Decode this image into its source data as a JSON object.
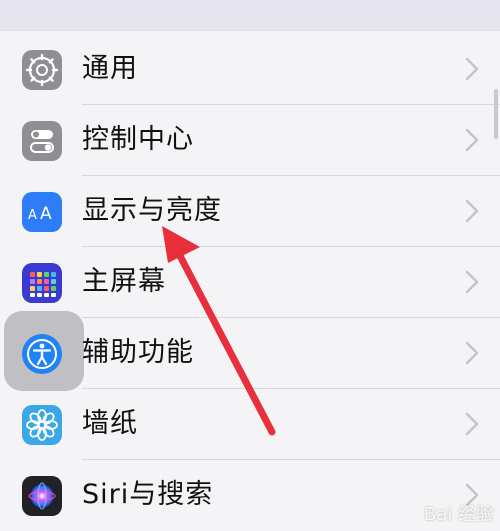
{
  "settings_list": {
    "items": [
      {
        "label": "通用",
        "icon": "gear-icon",
        "color": "#8e8e93"
      },
      {
        "label": "控制中心",
        "icon": "toggles-icon",
        "color": "#8e8e93"
      },
      {
        "label": "显示与亮度",
        "icon": "text-size-icon",
        "color": "#2e7cf6"
      },
      {
        "label": "主屏幕",
        "icon": "app-grid-icon",
        "color": "#3a3ad0"
      },
      {
        "label": "辅助功能",
        "icon": "accessibility-icon",
        "color": "#1f82f5"
      },
      {
        "label": "墙纸",
        "icon": "flower-icon",
        "color": "#39a7e8"
      },
      {
        "label": "Siri与搜索",
        "icon": "siri-icon",
        "color": "#222226"
      }
    ]
  },
  "annotation": {
    "arrow_color": "#e8303c"
  },
  "watermark": {
    "text": "Bai 经验"
  }
}
